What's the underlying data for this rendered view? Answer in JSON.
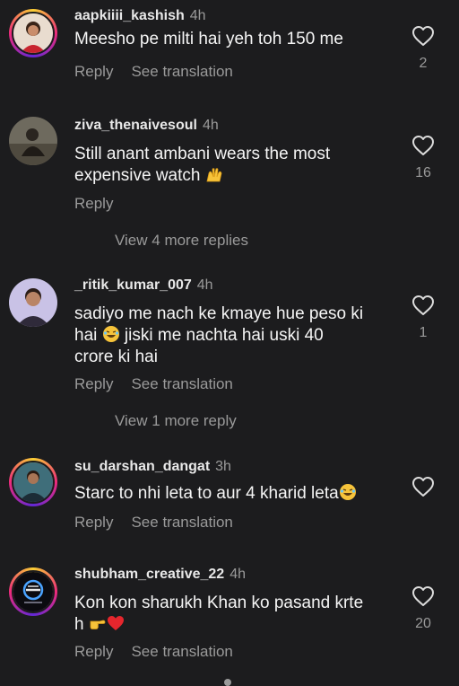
{
  "comments": [
    {
      "username": "aapkiiii_kashish",
      "time": "4h",
      "text": "Meesho pe milti hai yeh toh 150 me",
      "reply_label": "Reply",
      "translate_label": "See translation",
      "like_count": "2"
    },
    {
      "username": "ziva_thenaivesoul",
      "time": "4h",
      "text_line1": "Still anant ambani wears the most",
      "text_line2": "expensive watch",
      "reply_label": "Reply",
      "like_count": "16",
      "more_replies": "View 4 more replies"
    },
    {
      "username": "_ritik_kumar_007",
      "time": "4h",
      "text_line1": "sadiyo me nach ke kmaye hue peso ki",
      "text_line2a": "hai",
      "text_line2b": "jiski me nachta hai uski 40",
      "text_line3": "crore ki hai",
      "reply_label": "Reply",
      "translate_label": "See translation",
      "like_count": "1",
      "more_replies": "View 1 more reply"
    },
    {
      "username": "su_darshan_dangat",
      "time": "3h",
      "text": "Starc to nhi leta to aur 4 kharid leta",
      "reply_label": "Reply",
      "translate_label": "See translation"
    },
    {
      "username": "shubham_creative_22",
      "time": "4h",
      "text_line1": "Kon kon sharukh Khan ko pasand krte",
      "text_line2": "h",
      "reply_label": "Reply",
      "translate_label": "See translation",
      "like_count": "20"
    }
  ]
}
